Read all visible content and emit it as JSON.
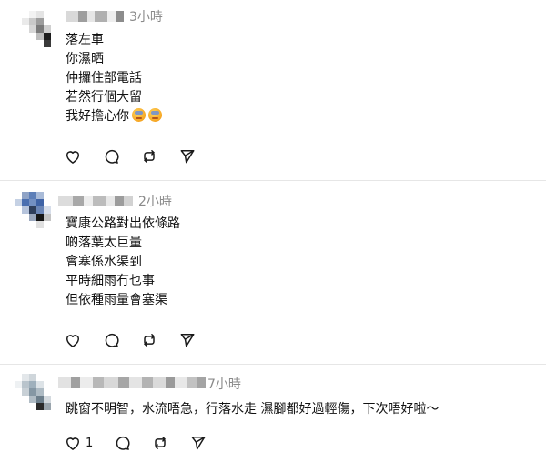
{
  "comments": [
    {
      "time": "3小時",
      "lines": [
        "落左車",
        "你濕晒",
        "仲攞住部電話",
        "若然行個大留",
        "我好擔心你"
      ],
      "emojis": [
        "worried-face-emoji",
        "worried-face-emoji"
      ],
      "like_count": ""
    },
    {
      "time": "2小時",
      "lines": [
        "寶康公路對出依條路",
        "啲落葉太巨量",
        "會塞係水渠到",
        "平時細雨冇乜事",
        "但依種雨量會塞渠"
      ],
      "like_count": ""
    },
    {
      "time": "7小時",
      "lines": [
        "跳窗不明智，水流唔急，行落水走 濕腳都好過輕傷，下次唔好啦～"
      ],
      "like_count": "1"
    }
  ],
  "icons": {
    "like": "heart-icon",
    "reply": "comment-bubble-icon",
    "repost": "repost-icon",
    "share": "send-icon"
  },
  "colors": {
    "timestamp": "#8a8a8a",
    "divider": "#e6e6e6"
  }
}
